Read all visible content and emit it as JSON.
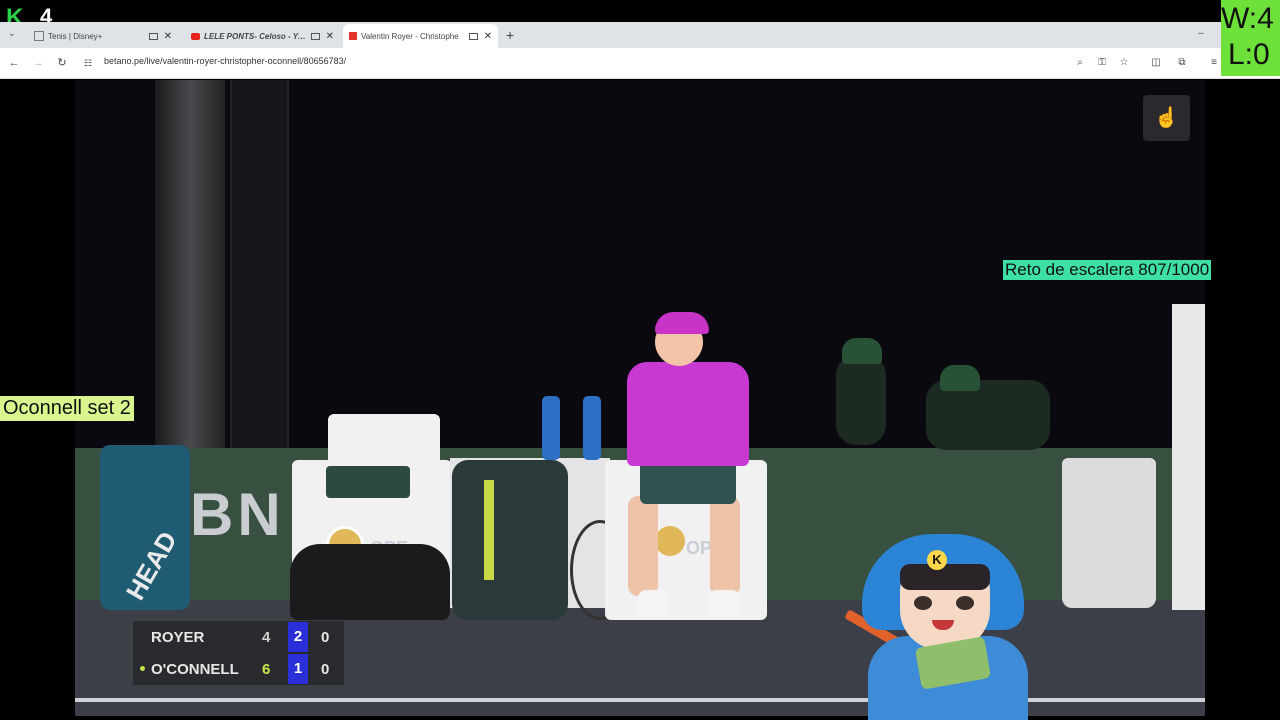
{
  "overlay": {
    "count_logo": "K",
    "count_value": "4",
    "wins": "W:4",
    "losses": "L:0",
    "challenge": "Reto de escalera 807/1000",
    "match_note": "Oconnell set 2",
    "avatar_badge": "K"
  },
  "browser": {
    "tabs": [
      {
        "label": "Tenis | Disney+",
        "icon": "disney-icon",
        "active": false
      },
      {
        "label": "LELE PONTS- Celoso - YouT",
        "icon": "youtube-icon",
        "active": false
      },
      {
        "label": "Valentin Royer - Christophe",
        "icon": "betano-icon",
        "active": true
      }
    ],
    "new_tab": "+",
    "close": "✕",
    "url": "betano.pe/live/valentin-royer-christopher-oconnell/80656783/"
  },
  "video": {
    "brand_text": "BN",
    "logo_text": "OPE",
    "bag_text": "HEAD"
  },
  "scoreboard": {
    "rows": [
      {
        "name": "ROYER",
        "set1": "4",
        "set2": "2",
        "points": "0",
        "serving": false
      },
      {
        "name": "O'CONNELL",
        "set1": "6",
        "set2": "1",
        "points": "0",
        "serving": true
      }
    ]
  },
  "colors": {
    "wl_bg": "#6ee03a",
    "challenge_bg": "#3ee0a6",
    "note_bg": "#d8f58e",
    "set_highlight": "#2b2fd8"
  }
}
